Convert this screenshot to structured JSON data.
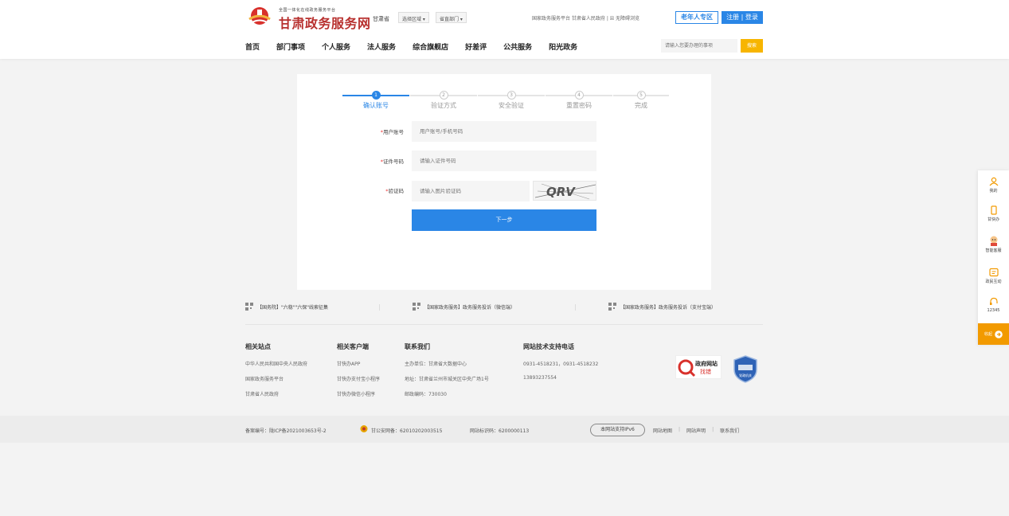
{
  "header": {
    "logo_sub": "全国一体化在线政务服务平台",
    "logo_main": "甘肃政务服务网",
    "province": "甘肃省",
    "region_select": "选择区域",
    "dept_select": "省直部门",
    "top_links": "国家政务服务平台  甘肃省人民政府  |  ☒ 无障碍浏览",
    "elder_label": "老年人专区",
    "register_login": "注册 | 登录",
    "search_placeholder": "请输入您要办理的事项",
    "search_button": "搜索"
  },
  "nav": [
    "首页",
    "部门事项",
    "个人服务",
    "法人服务",
    "综合旗舰店",
    "好差评",
    "公共服务",
    "阳光政务"
  ],
  "steps": [
    {
      "num": "1",
      "label": "确认账号"
    },
    {
      "num": "2",
      "label": "验证方式"
    },
    {
      "num": "3",
      "label": "安全验证"
    },
    {
      "num": "4",
      "label": "重置密码"
    },
    {
      "num": "5",
      "label": "完成"
    }
  ],
  "form": {
    "account_label": "用户账号",
    "account_placeholder": "用户账号/手机号码",
    "id_label": "证件号码",
    "id_placeholder": "请输入证件号码",
    "captcha_label": "验证码",
    "captcha_placeholder": "请输入图片验证码",
    "captcha_text": "QRV",
    "next_button": "下一步"
  },
  "footer_links": [
    "【国务院】\"六稳\"\"六保\"线索征集",
    "【国家政务服务】政务服务投诉（微信端）",
    "【国家政务服务】政务服务投诉（支付宝端）"
  ],
  "footer_cols": [
    {
      "head": "相关站点",
      "rows": [
        "中华人民共和国中央人民政府",
        "国家政务服务平台",
        "甘肃省人民政府"
      ]
    },
    {
      "head": "相关客户端",
      "rows": [
        "甘快办APP",
        "甘快办支付宝小程序",
        "甘快办微信小程序"
      ]
    },
    {
      "head": "联系我们",
      "rows": [
        "主办单位：甘肃省大数据中心",
        "地址：甘肃省兰州市城关区中央广场1号",
        "邮政编码：730030"
      ]
    },
    {
      "head": "网站技术支持电话",
      "rows": [
        "0931-4518231，0931-4518232",
        "13893237554"
      ]
    }
  ],
  "badges": {
    "gov_line1": "政府网站",
    "gov_line2": "找错",
    "shield_text": "党政机关"
  },
  "bottom": {
    "icp": "备案编号：陇ICP备2021003653号-2",
    "police": "甘公安网备：62010202003515",
    "site_id": "网站标识码：6200000113",
    "ipv6": "本网站支持IPv6",
    "links": [
      "网站地图",
      "网站声明",
      "联系我们"
    ]
  },
  "sidebar": {
    "items": [
      "我的",
      "甘快办",
      "智能客服",
      "政民互动",
      "12345"
    ],
    "bottom": "收起"
  },
  "colors": {
    "accent": "#2a86e6",
    "brand_red": "#b8312f",
    "search_yellow": "#f7b500",
    "sidebar_orange": "#f29a00"
  }
}
